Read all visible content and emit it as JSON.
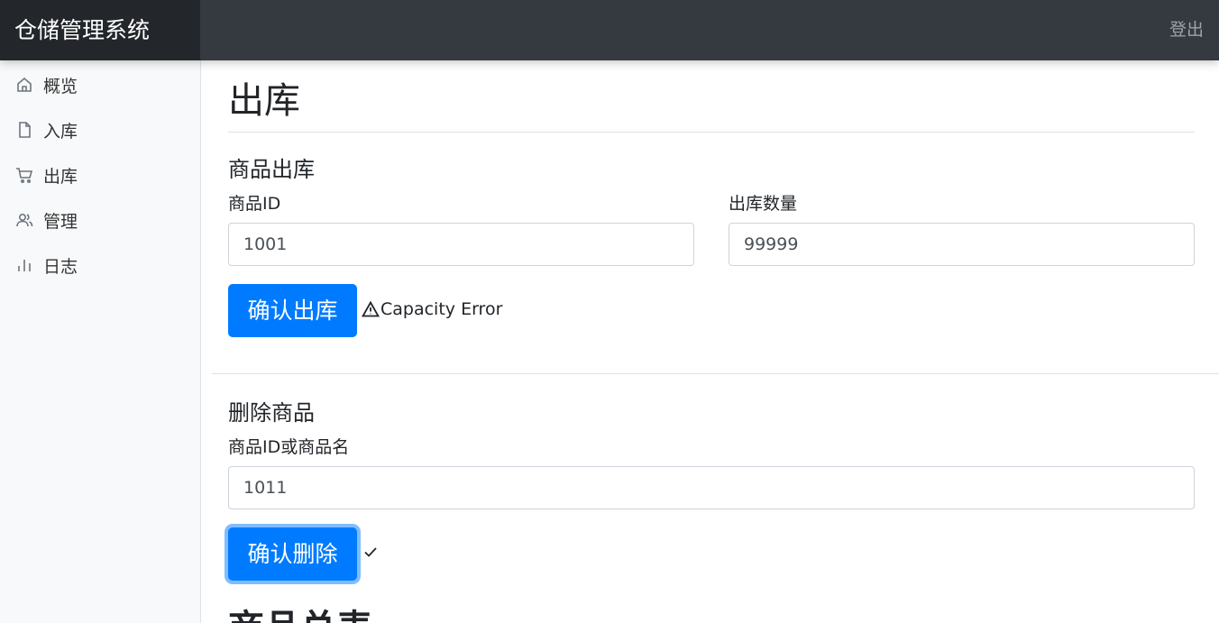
{
  "header": {
    "brand": "仓储管理系统",
    "logout_label": "登出"
  },
  "sidebar": {
    "items": [
      {
        "label": "概览",
        "icon": "home-icon"
      },
      {
        "label": "入库",
        "icon": "file-icon"
      },
      {
        "label": "出库",
        "icon": "cart-icon"
      },
      {
        "label": "管理",
        "icon": "users-icon"
      },
      {
        "label": "日志",
        "icon": "bar-chart-icon"
      }
    ]
  },
  "main": {
    "page_title": "出库",
    "outbound": {
      "section_title": "商品出库",
      "product_id_label": "商品ID",
      "product_id_value": "1001",
      "quantity_label": "出库数量",
      "quantity_value": "99999",
      "confirm_label": "确认出库",
      "status_text": "Capacity Error",
      "status_icon": "warning-icon"
    },
    "delete": {
      "section_title": "删除商品",
      "field_label": "商品ID或商品名",
      "field_value": "1011",
      "confirm_label": "确认删除",
      "status_icon": "check-icon"
    },
    "summary_title": "商品总表"
  },
  "colors": {
    "primary": "#007bff",
    "topbar": "#343a40",
    "brand_bg": "#23272b",
    "sidebar_bg": "#f8f9fa"
  }
}
